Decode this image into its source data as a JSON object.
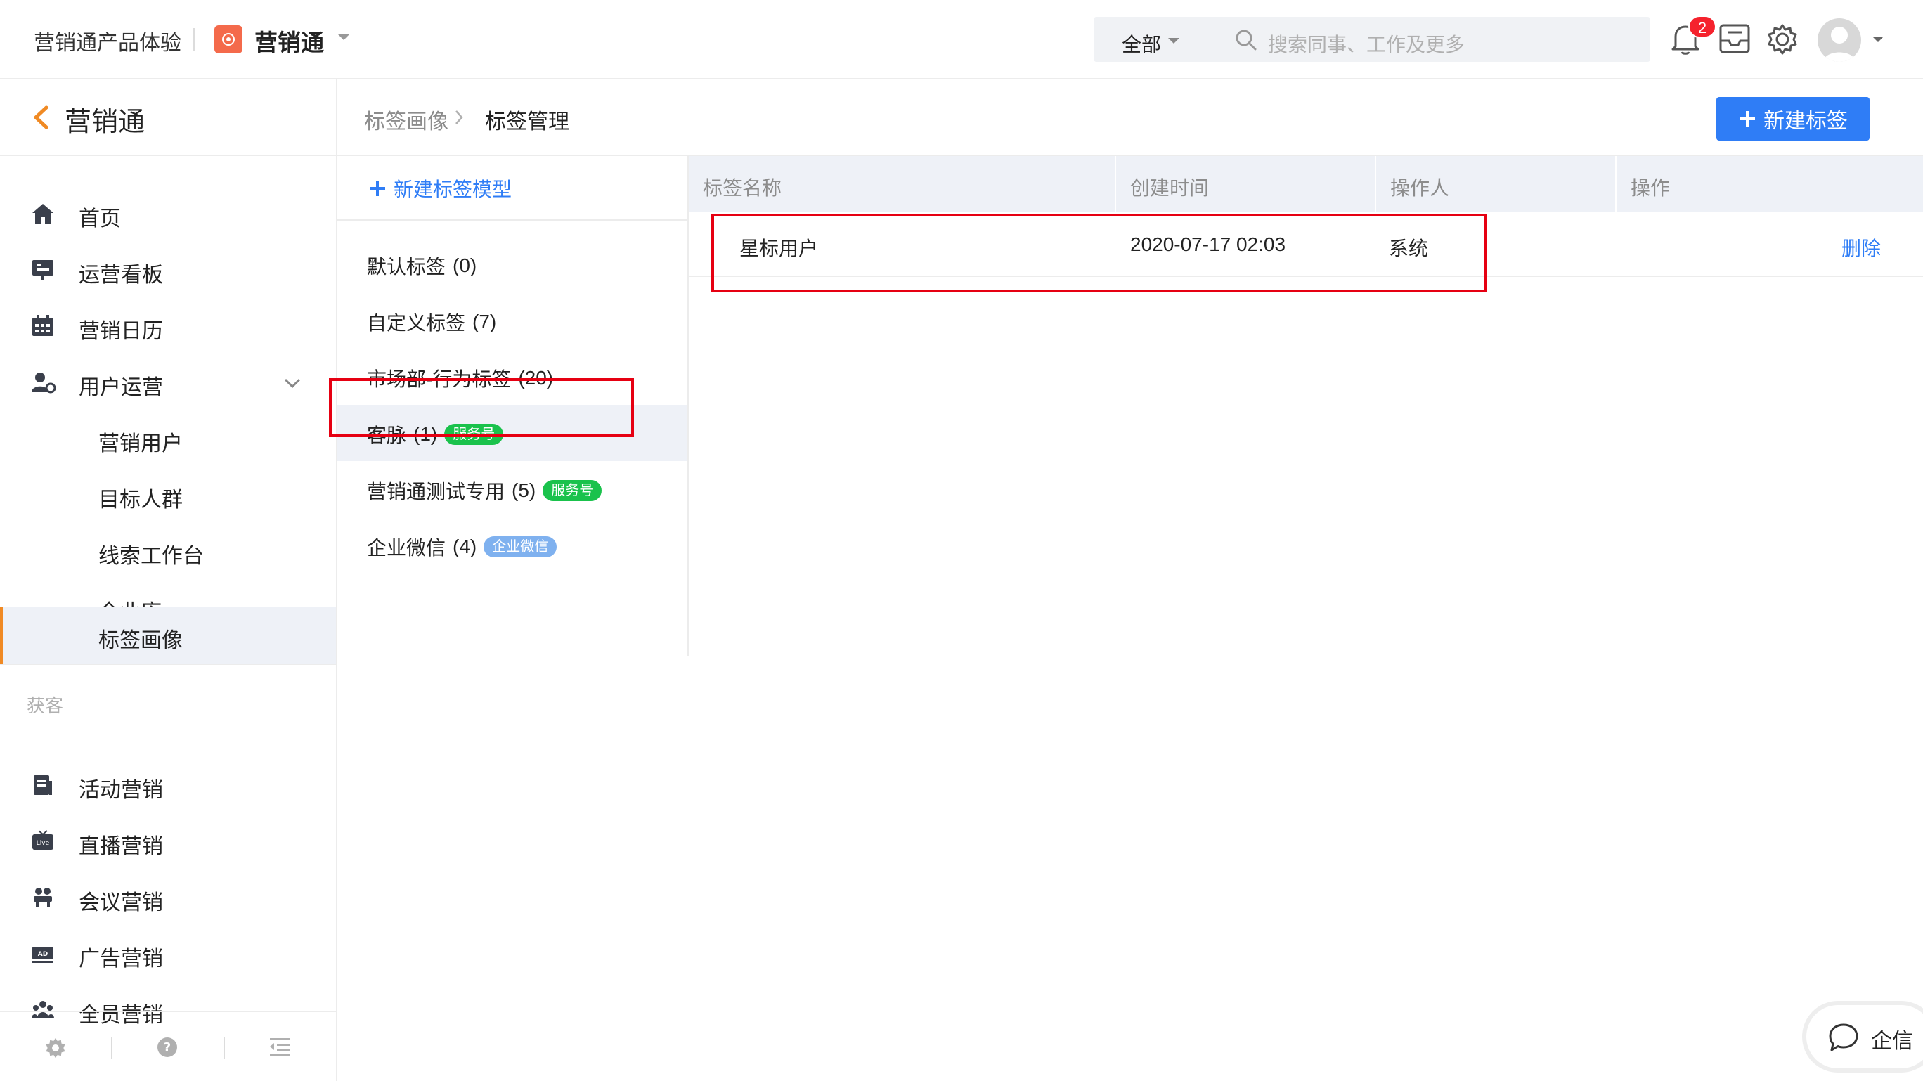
{
  "topbar": {
    "org_name": "营销通产品体验",
    "app_name": "营销通",
    "search_scope": "全部",
    "search_placeholder": "搜索同事、工作及更多",
    "notification_count": "2"
  },
  "sidebar": {
    "title": "营销通",
    "items": [
      {
        "label": "首页",
        "icon": "home-icon"
      },
      {
        "label": "运营看板",
        "icon": "dashboard-icon"
      },
      {
        "label": "营销日历",
        "icon": "calendar-icon"
      },
      {
        "label": "用户运营",
        "icon": "user-ops-icon"
      }
    ],
    "sub_items": [
      "营销用户",
      "目标人群",
      "线索工作台",
      "企业库",
      "标签画像"
    ],
    "active_item": "标签画像",
    "group_label": "获客",
    "group_items": [
      {
        "label": "活动营销",
        "icon": "activity-icon"
      },
      {
        "label": "直播营销",
        "icon": "live-icon"
      },
      {
        "label": "会议营销",
        "icon": "meeting-icon"
      },
      {
        "label": "广告营销",
        "icon": "ad-icon"
      },
      {
        "label": "全员营销",
        "icon": "team-icon"
      }
    ]
  },
  "breadcrumb": {
    "parent": "标签画像",
    "current": "标签管理"
  },
  "actions": {
    "new_tag": "新建标签",
    "new_model": "新建标签模型"
  },
  "models": [
    {
      "name": "默认标签",
      "count": "(0)",
      "badge": ""
    },
    {
      "name": "自定义标签",
      "count": "(7)",
      "badge": ""
    },
    {
      "name": "市场部-行为标签",
      "count": "(20)",
      "badge": ""
    },
    {
      "name": "客脉",
      "count": "(1)",
      "badge": "服务号"
    },
    {
      "name": "营销通测试专用",
      "count": "(5)",
      "badge": "服务号"
    },
    {
      "name": "企业微信",
      "count": "(4)",
      "badge": "企业微信"
    }
  ],
  "table": {
    "columns": [
      "标签名称",
      "创建时间",
      "操作人",
      "操作"
    ],
    "rows": [
      {
        "name": "星标用户",
        "created": "2020-07-17 02:03",
        "operator": "系统",
        "action": "删除"
      }
    ]
  },
  "floating": {
    "label": "企信"
  },
  "colors": {
    "primary": "#2f7df6",
    "accent": "#f08a24",
    "service_badge": "#1ac24c",
    "wecom_badge": "#7fb1ef",
    "highlight": "#e60012"
  }
}
